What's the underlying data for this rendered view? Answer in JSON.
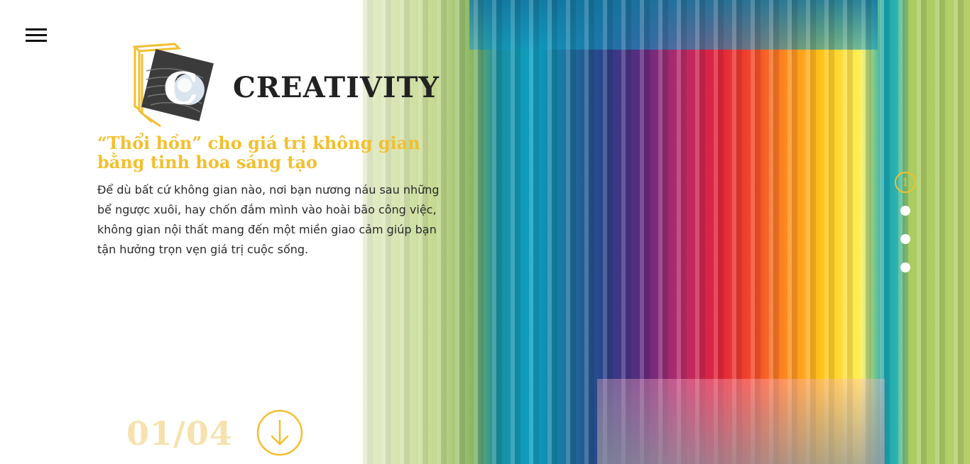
{
  "brand": {
    "name": "CREATIVITY",
    "logo_letter": "C"
  },
  "hero": {
    "headline_line1": "“Thổi hồn” cho giá trị không gian",
    "headline_line2": "bằng tinh hoa sáng tạo",
    "body_lines": [
      "Để dù bất cứ không gian nào, nơi bạn nương náu sau những",
      "bể ngược xuôi, hay chốn đắm mình vào hoài bão công việc,",
      "không gian nội thất mang đến một miền giao cảm giúp bạn",
      "tận hưởng trọn vẹn giá trị cuộc sống."
    ]
  },
  "pager": {
    "counter": "01/04",
    "active_slide_label": "1",
    "total_slides": 4,
    "current_slide": 1
  },
  "colors": {
    "accent": "#f2bf2e",
    "counter": "#f6e2ae",
    "text": "#2a2a2a",
    "logo_text": "#222222"
  },
  "icons": {
    "menu": "hamburger-icon",
    "scroll": "arrow-down-circle-icon"
  }
}
